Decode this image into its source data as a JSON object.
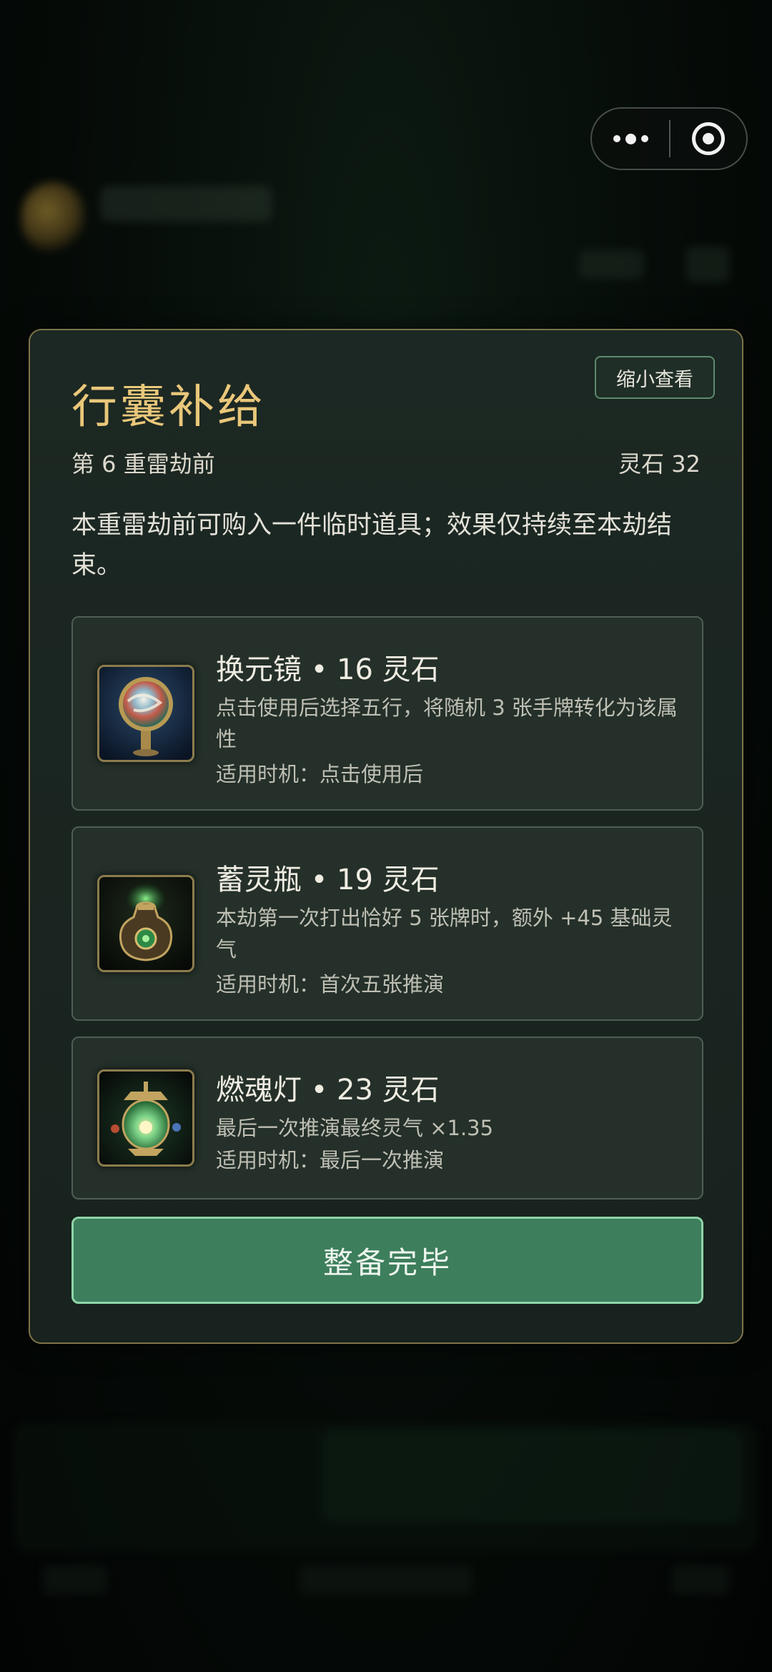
{
  "capsule": {
    "more_icon": "more-dots-icon",
    "close_icon": "target-close-icon"
  },
  "modal": {
    "title": "行囊补给",
    "shrink_button": "缩小查看",
    "stage": "第 6 重雷劫前",
    "spirit_stones": "灵石 32",
    "description": "本重雷劫前可购入一件临时道具；效果仅持续至本劫结束。",
    "items": [
      {
        "name": "换元镜 • 16 灵石",
        "effect": "点击使用后选择五行，将随机 3 张手牌转化为该属性",
        "timing": "适用时机：点击使用后",
        "icon": "mirror-icon"
      },
      {
        "name": "蓄灵瓶 • 19 灵石",
        "effect": "本劫第一次打出恰好 5 张牌时，额外 +45 基础灵气",
        "timing": "适用时机：首次五张推演",
        "icon": "spirit-vase-icon"
      },
      {
        "name": "燃魂灯 • 23 灵石",
        "effect": "最后一次推演最终灵气 ×1.35",
        "timing": "适用时机：最后一次推演",
        "icon": "soul-lantern-icon"
      }
    ],
    "done_button": "整备完毕"
  },
  "colors": {
    "title_gold": "#e9c77a",
    "modal_border": "#7d7448",
    "button_green": "#3d7e5c",
    "button_border": "#8fd4a8"
  }
}
